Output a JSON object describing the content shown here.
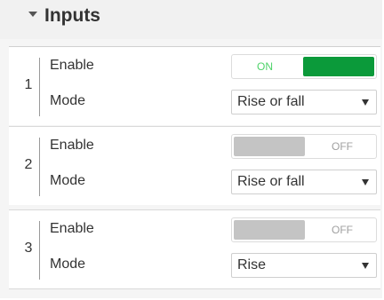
{
  "panel": {
    "title": "Inputs",
    "expanded": true
  },
  "inputs": [
    {
      "index": "1",
      "enable_label": "Enable",
      "enable_state": "ON",
      "enabled": true,
      "mode_label": "Mode",
      "mode_value": "Rise or fall"
    },
    {
      "index": "2",
      "enable_label": "Enable",
      "enable_state": "OFF",
      "enabled": false,
      "mode_label": "Mode",
      "mode_value": "Rise or fall"
    },
    {
      "index": "3",
      "enable_label": "Enable",
      "enable_state": "OFF",
      "enabled": false,
      "mode_label": "Mode",
      "mode_value": "Rise"
    }
  ],
  "colors": {
    "toggle_on_fill": "#0b9a3a",
    "toggle_on_text": "#4fd36a",
    "toggle_off_fill": "#c4c4c4",
    "toggle_off_text": "#a0a0a0"
  },
  "icons": {
    "collapse": "caret-down-icon",
    "dropdown": "chevron-down-icon"
  }
}
